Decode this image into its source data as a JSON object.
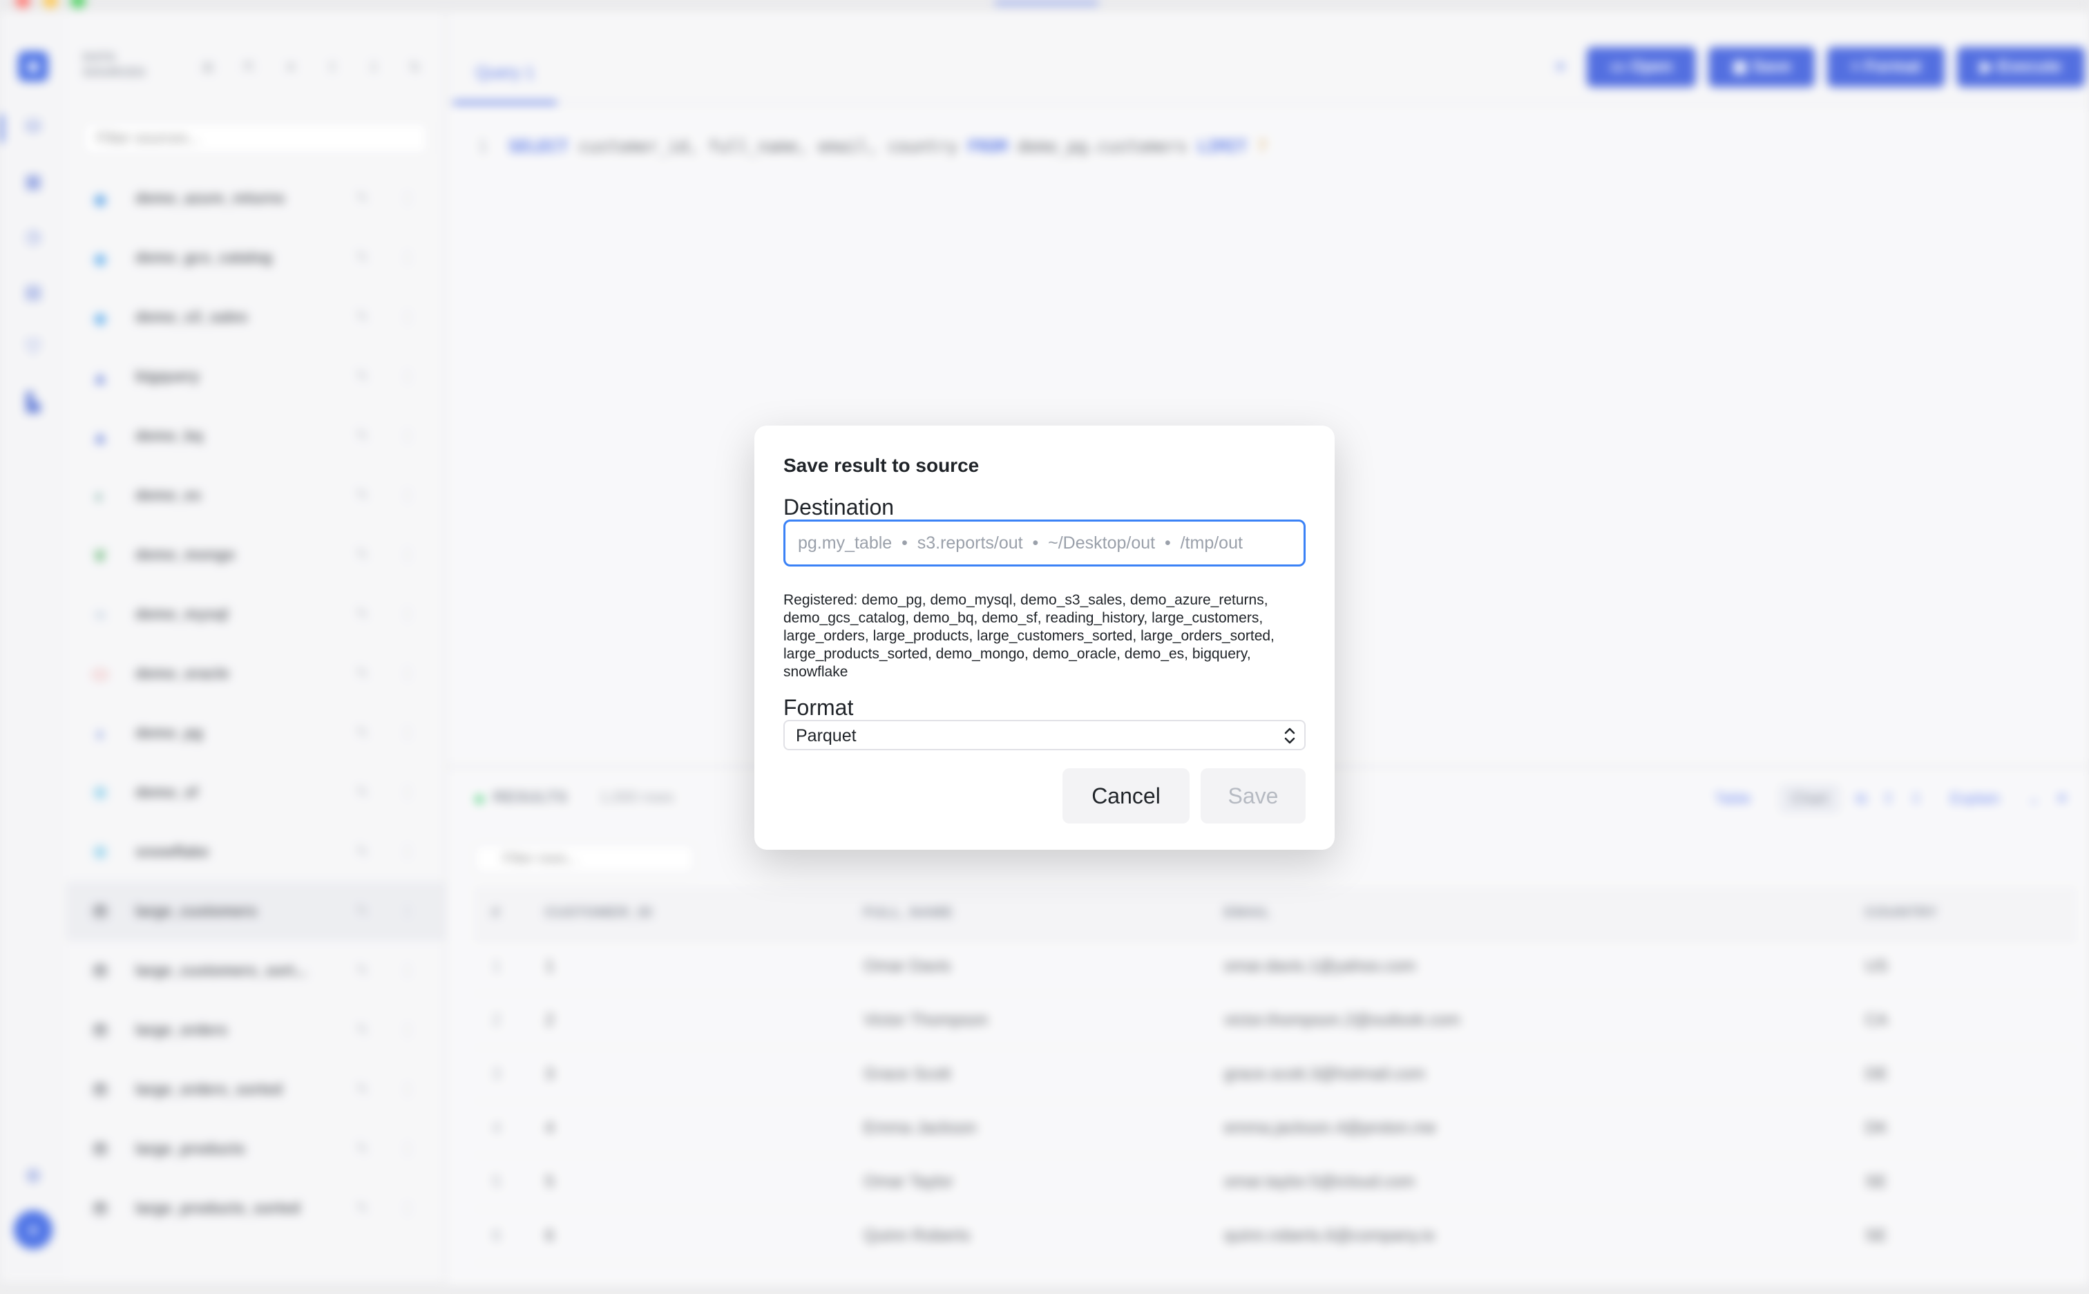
{
  "window": {
    "title": ""
  },
  "sidebar": {
    "title": "DATA SOURCES",
    "filter_placeholder": "Filter sources...",
    "items": [
      {
        "name": "demo_azure_returns",
        "icon": "azure-icon"
      },
      {
        "name": "demo_gcs_catalog",
        "icon": "gcs-icon"
      },
      {
        "name": "demo_s3_sales",
        "icon": "s3-icon"
      },
      {
        "name": "bigquery",
        "icon": "bigquery-icon"
      },
      {
        "name": "demo_bq",
        "icon": "bigquery-icon"
      },
      {
        "name": "demo_es",
        "icon": "elasticsearch-icon"
      },
      {
        "name": "demo_mongo",
        "icon": "mongo-icon"
      },
      {
        "name": "demo_mysql",
        "icon": "mysql-icon"
      },
      {
        "name": "demo_oracle",
        "icon": "oracle-icon"
      },
      {
        "name": "demo_pg",
        "icon": "postgres-icon"
      },
      {
        "name": "demo_sf",
        "icon": "snowflake-icon"
      },
      {
        "name": "snowflake",
        "icon": "snowflake-icon"
      },
      {
        "name": "large_customers",
        "icon": "file-db-icon"
      },
      {
        "name": "large_customers_sort...",
        "icon": "file-db-icon"
      },
      {
        "name": "large_orders",
        "icon": "file-db-icon"
      },
      {
        "name": "large_orders_sorted",
        "icon": "file-db-icon"
      },
      {
        "name": "large_products",
        "icon": "file-db-icon"
      },
      {
        "name": "large_products_sorted",
        "icon": "file-db-icon"
      }
    ]
  },
  "editor": {
    "tab_label": "Query 1",
    "toolbar": {
      "open": "Open",
      "save": "Save",
      "format": "Format",
      "execute": "Execute"
    },
    "sql": {
      "line_no": "1",
      "kw_select": "SELECT",
      "columns": "customer_id, full_name, email, country",
      "kw_from": "FROM",
      "table": "demo_pg.customers",
      "kw_limit": "LIMIT",
      "limit": "?"
    }
  },
  "results": {
    "label": "RESULTS",
    "meta": "1,000 rows",
    "filter_placeholder": "Filter rows...",
    "table_btn": "Table",
    "chart_btn": "Chart",
    "explain_btn": "Explain",
    "columns": [
      "#",
      "CUSTOMER_ID",
      "FULL_NAME",
      "EMAIL",
      "COUNTRY"
    ],
    "rows": [
      [
        "1",
        "1",
        "Omar Davis",
        "omar.davis.1@yahoo.com",
        "US"
      ],
      [
        "2",
        "2",
        "Victor Thompson",
        "victor.thompson.2@outlook.com",
        "CA"
      ],
      [
        "3",
        "3",
        "Grace Scott",
        "grace.scott.3@hotmail.com",
        "DE"
      ],
      [
        "4",
        "4",
        "Emma Jackson",
        "emma.jackson.4@proton.me",
        "DK"
      ],
      [
        "5",
        "5",
        "Omar Taylor",
        "omar.taylor.5@icloud.com",
        "SE"
      ],
      [
        "6",
        "6",
        "Quinn Roberts",
        "quinn.roberts.6@company.io",
        "SE"
      ]
    ]
  },
  "modal": {
    "title": "Save result to source",
    "destination_label": "Destination",
    "destination_placeholder": "pg.my_table  •  s3.reports/out  •  ~/Desktop/out  •  /tmp/out",
    "destination_value": "",
    "registered_text": "Registered: demo_pg, demo_mysql, demo_s3_sales, demo_azure_returns, demo_gcs_catalog, demo_bq, demo_sf, reading_history, large_customers, large_orders, large_products, large_customers_sorted, large_orders_sorted, large_products_sorted, demo_mongo, demo_oracle, demo_es, bigquery, snowflake",
    "format_label": "Format",
    "format_value": "Parquet",
    "cancel_label": "Cancel",
    "save_label": "Save"
  },
  "colors": {
    "accent": "#2347d8",
    "focus": "#3b82f6",
    "success": "#22c55e"
  }
}
